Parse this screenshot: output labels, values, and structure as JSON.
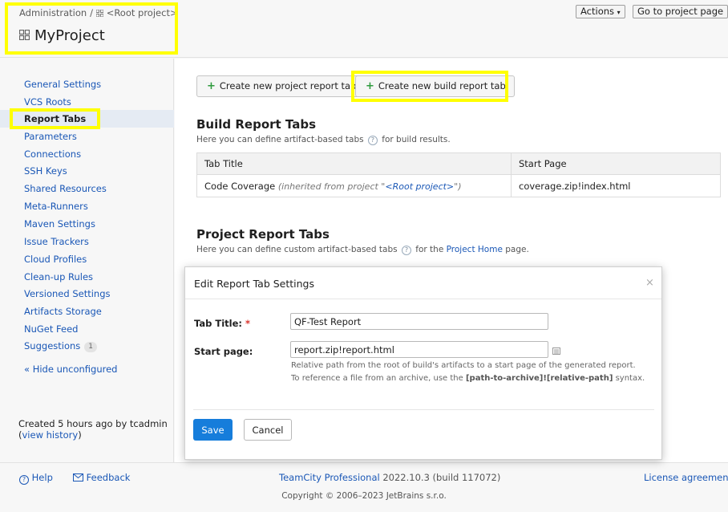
{
  "header": {
    "breadcrumb_admin": "Administration",
    "breadcrumb_sep": "/",
    "breadcrumb_root": "<Root project>",
    "title": "MyProject",
    "actions_label": "Actions",
    "goto_label": "Go to project page"
  },
  "sidebar": {
    "items": [
      {
        "label": "General Settings"
      },
      {
        "label": "VCS Roots"
      },
      {
        "label": "Report Tabs"
      },
      {
        "label": "Parameters"
      },
      {
        "label": "Connections"
      },
      {
        "label": "SSH Keys"
      },
      {
        "label": "Shared Resources"
      },
      {
        "label": "Meta-Runners"
      },
      {
        "label": "Maven Settings"
      },
      {
        "label": "Issue Trackers"
      },
      {
        "label": "Cloud Profiles"
      },
      {
        "label": "Clean-up Rules"
      },
      {
        "label": "Versioned Settings"
      },
      {
        "label": "Artifacts Storage"
      },
      {
        "label": "NuGet Feed"
      },
      {
        "label": "Suggestions",
        "badge": "1"
      }
    ],
    "active_index": 2,
    "hide_unconfigured": "« Hide unconfigured",
    "created_text": "Created 5 hours ago by tcadmin",
    "view_history": "view history"
  },
  "main": {
    "btn_project": "Create new project report tab",
    "btn_build": "Create new build report tab",
    "build_section": {
      "title": "Build Report Tabs",
      "desc_before": "Here you can define artifact-based tabs",
      "desc_after": "for build results."
    },
    "table": {
      "headers": [
        "Tab Title",
        "Start Page"
      ],
      "rows": [
        {
          "title": "Code Coverage",
          "inherited_prefix": "(inherited from project \"",
          "inherited_link": "<Root project>",
          "inherited_suffix": "\")",
          "start_page": "coverage.zip!index.html"
        }
      ]
    },
    "project_section": {
      "title": "Project Report Tabs",
      "desc_before": "Here you can define custom artifact-based tabs",
      "desc_middle": "for the",
      "desc_link": "Project Home",
      "desc_after": "page."
    }
  },
  "dialog": {
    "title": "Edit Report Tab Settings",
    "close": "×",
    "tab_title_label": "Tab Title:",
    "required_mark": "*",
    "tab_title_value": "QF-Test Report",
    "start_page_label": "Start page:",
    "start_page_value": "report.zip!report.html",
    "hint1": "Relative path from the root of build's artifacts to a start page of the generated report.",
    "hint2_before": "To reference a file from an archive, use the",
    "hint2_bold": "[path-to-archive]![relative-path]",
    "hint2_after": "syntax.",
    "save": "Save",
    "cancel": "Cancel"
  },
  "footer": {
    "help": "Help",
    "feedback": "Feedback",
    "product_link": "TeamCity Professional",
    "version": "2022.10.3 (build 117072)",
    "license": "License agreement",
    "copyright": "Copyright © 2006–2023 JetBrains s.r.o."
  },
  "colors": {
    "link": "#1a57b6",
    "primary_button": "#167ddb",
    "highlight": "#ffff00",
    "plus_icon": "#2e9b3d"
  }
}
